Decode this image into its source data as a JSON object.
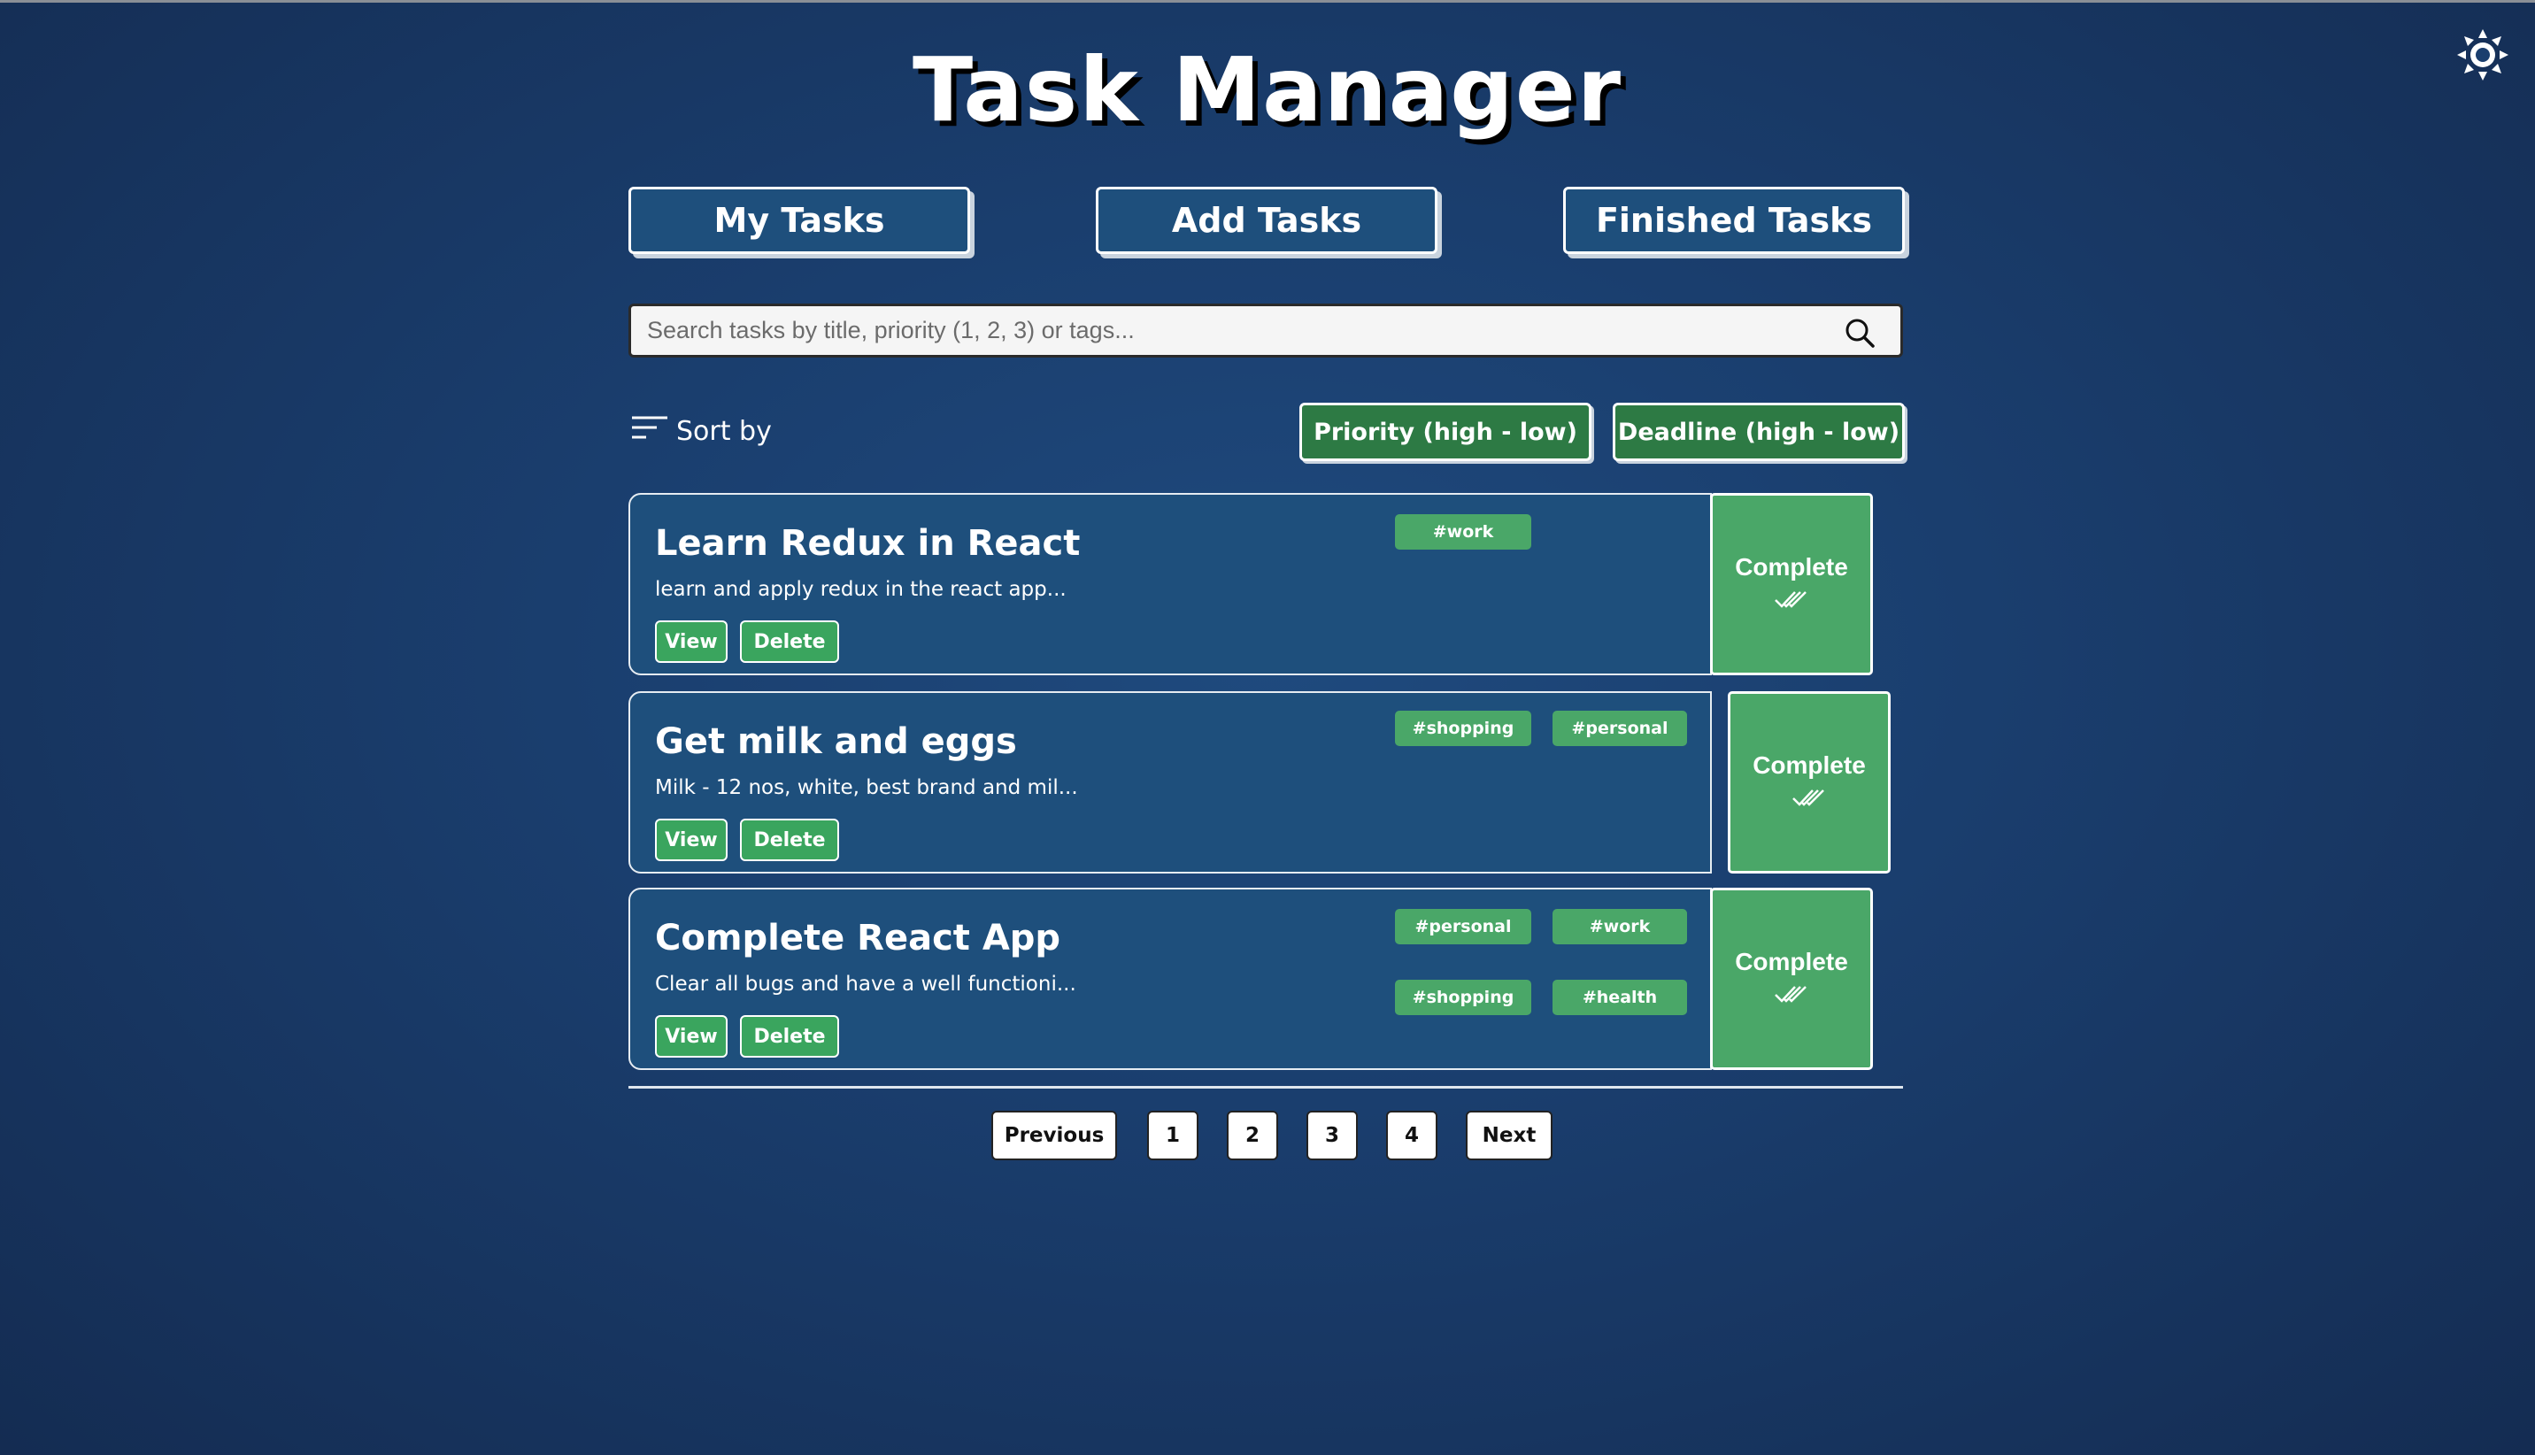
{
  "app": {
    "title": "Task Manager",
    "theme_icon": "sun-icon"
  },
  "nav": {
    "my_tasks": "My Tasks",
    "add_tasks": "Add Tasks",
    "finished_tasks": "Finished Tasks"
  },
  "search": {
    "placeholder": "Search tasks by title, priority (1, 2, 3) or tags...",
    "value": "",
    "icon": "search-icon"
  },
  "sort": {
    "label": "Sort by",
    "icon": "sort-lines-icon",
    "priority": "Priority (high - low)",
    "deadline": "Deadline (high - low)"
  },
  "tasks": [
    {
      "title": "Learn Redux in React",
      "description": "learn and apply redux in the react app...",
      "tags": [
        "#work"
      ],
      "view": "View",
      "delete": "Delete",
      "complete": "Complete"
    },
    {
      "title": "Get milk and eggs",
      "description": "Milk - 12 nos, white, best brand and mil...",
      "tags": [
        "#shopping",
        "#personal"
      ],
      "view": "View",
      "delete": "Delete",
      "complete": "Complete"
    },
    {
      "title": "Complete React App",
      "description": "Clear all bugs and have a well functioni...",
      "tags": [
        "#personal",
        "#work",
        "#shopping",
        "#health"
      ],
      "view": "View",
      "delete": "Delete",
      "complete": "Complete"
    }
  ],
  "pagination": {
    "previous": "Previous",
    "pages": [
      "1",
      "2",
      "3",
      "4"
    ],
    "next": "Next"
  },
  "colors": {
    "background": "#1a3e6e",
    "card": "#1e4f7c",
    "green": "#4aa768",
    "dark_green": "#2d7a44"
  }
}
